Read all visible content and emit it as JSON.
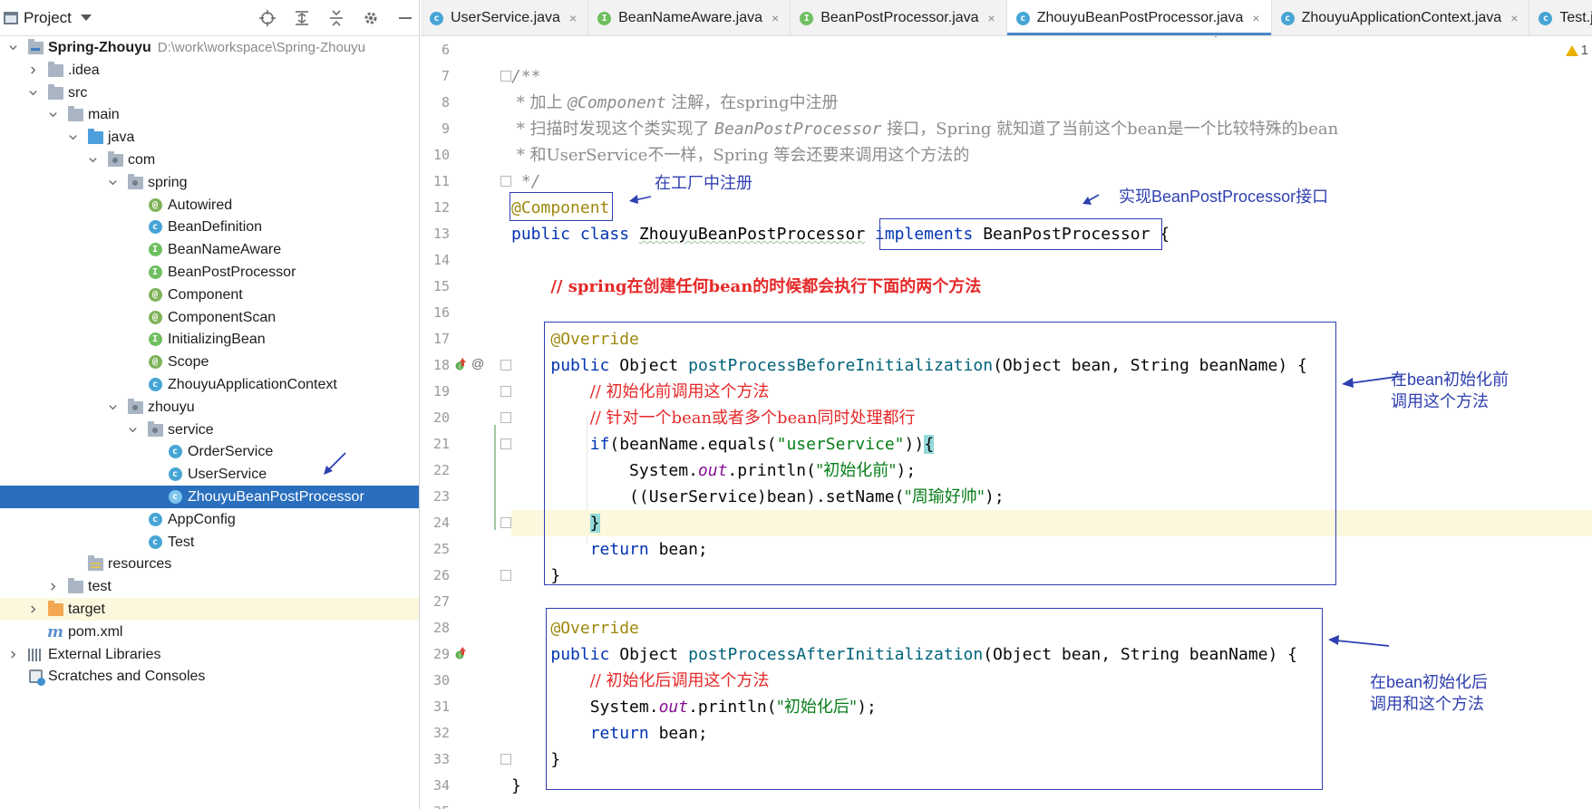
{
  "project_panel": {
    "title": "Project",
    "tree": [
      {
        "label": "Spring-Zhouyu",
        "path": "D:\\work\\workspace\\Spring-Zhouyu",
        "icon": "module-folder-icon",
        "depth": 0,
        "expanded": true
      },
      {
        "label": ".idea",
        "icon": "folder-icon",
        "depth": 1,
        "expanded": false
      },
      {
        "label": "src",
        "icon": "folder-icon",
        "depth": 1,
        "expanded": true
      },
      {
        "label": "main",
        "icon": "folder-icon",
        "depth": 2,
        "expanded": true
      },
      {
        "label": "java",
        "icon": "source-folder-icon",
        "depth": 3,
        "expanded": true
      },
      {
        "label": "com",
        "icon": "package-icon",
        "depth": 4,
        "expanded": true
      },
      {
        "label": "spring",
        "icon": "package-icon",
        "depth": 5,
        "expanded": true
      },
      {
        "label": "Autowired",
        "icon": "annotation-icon",
        "depth": 6
      },
      {
        "label": "BeanDefinition",
        "icon": "class-icon",
        "depth": 6
      },
      {
        "label": "BeanNameAware",
        "icon": "interface-icon",
        "depth": 6
      },
      {
        "label": "BeanPostProcessor",
        "icon": "interface-icon",
        "depth": 6
      },
      {
        "label": "Component",
        "icon": "annotation-icon",
        "depth": 6
      },
      {
        "label": "ComponentScan",
        "icon": "annotation-icon",
        "depth": 6
      },
      {
        "label": "InitializingBean",
        "icon": "interface-icon",
        "depth": 6
      },
      {
        "label": "Scope",
        "icon": "annotation-icon",
        "depth": 6
      },
      {
        "label": "ZhouyuApplicationContext",
        "icon": "class-icon",
        "depth": 6
      },
      {
        "label": "zhouyu",
        "icon": "package-icon",
        "depth": 5,
        "expanded": true
      },
      {
        "label": "service",
        "icon": "package-icon",
        "depth": 6,
        "expanded": true
      },
      {
        "label": "OrderService",
        "icon": "class-icon",
        "depth": 7
      },
      {
        "label": "UserService",
        "icon": "class-icon",
        "depth": 7
      },
      {
        "label": "ZhouyuBeanPostProcessor",
        "icon": "class-icon",
        "depth": 7,
        "selected": true
      },
      {
        "label": "AppConfig",
        "icon": "class-icon",
        "depth": 6
      },
      {
        "label": "Test",
        "icon": "runnable-class-icon",
        "depth": 6
      },
      {
        "label": "resources",
        "icon": "resources-folder-icon",
        "depth": 3
      },
      {
        "label": "test",
        "icon": "folder-icon",
        "depth": 2,
        "expanded": false
      },
      {
        "label": "target",
        "icon": "excluded-folder-icon",
        "depth": 1,
        "expanded": false,
        "highlighted": true
      },
      {
        "label": "pom.xml",
        "icon": "maven-icon",
        "depth": 1
      },
      {
        "label": "External Libraries",
        "icon": "library-icon",
        "depth": 0,
        "expanded": false
      },
      {
        "label": "Scratches and Consoles",
        "icon": "scratch-icon",
        "depth": 0
      }
    ]
  },
  "tabs": [
    {
      "label": "UserService.java",
      "icon": "class-icon",
      "close": "×"
    },
    {
      "label": "BeanNameAware.java",
      "icon": "interface-icon",
      "close": "×"
    },
    {
      "label": "BeanPostProcessor.java",
      "icon": "interface-icon",
      "close": "×"
    },
    {
      "label": "ZhouyuBeanPostProcessor.java",
      "icon": "class-icon",
      "close": "×",
      "active": true
    },
    {
      "label": "ZhouyuApplicationContext.java",
      "icon": "class-icon",
      "close": "×"
    },
    {
      "label": "Test.ja",
      "icon": "runnable-class-icon",
      "close": ""
    }
  ],
  "editor": {
    "warning_count": "1",
    "line_numbers": [
      "6",
      "7",
      "8",
      "9",
      "10",
      "11",
      "12",
      "13",
      "14",
      "15",
      "16",
      "17",
      "18",
      "19",
      "20",
      "21",
      "22",
      "23",
      "24",
      "25",
      "26",
      "27",
      "28",
      "29",
      "30",
      "31",
      "32",
      "33",
      "34",
      "35"
    ],
    "code": {
      "l7": "/**",
      "l8_a": " * 加上 ",
      "l8_b": "@Component",
      "l8_c": " 注解，在spring中注册",
      "l9_a": " * 扫描时发现这个类实现了 ",
      "l9_b": "BeanPostProcessor",
      "l9_c": " 接口，Spring 就知道了当前这个bean是一个比较特殊的bean",
      "l10": " * 和UserService不一样，Spring 等会还要来调用这个方法的",
      "l11": " */",
      "l12": "@Component",
      "l13_kw1": "public",
      "l13_kw2": "class",
      "l13_name": "ZhouyuBeanPostProcessor",
      "l13_kw3": "implements",
      "l13_iface": "BeanPostProcessor",
      "l13_brace": "{",
      "l15": "// spring在创建任何bean的时候都会执行下面的两个方法",
      "l17": "@Override",
      "l18_kw": "public",
      "l18_type": "Object",
      "l18_fn": "postProcessBeforeInitialization",
      "l18_params": "(Object bean, String beanName) {",
      "l19": "// 初始化前调用这个方法",
      "l20": "// 针对一个bean或者多个bean同时处理都行",
      "l21_kw": "if",
      "l21_a": "(beanName.equals(",
      "l21_str": "\"userService\"",
      "l21_b": "))",
      "l21_brace": "{",
      "l22_a": "System.",
      "l22_field": "out",
      "l22_b": ".println(",
      "l22_str": "\"初始化前\"",
      "l22_c": ");",
      "l23_a": "((UserService)bean).setName(",
      "l23_str": "\"周瑜好帅\"",
      "l23_b": ");",
      "l24": "}",
      "l25_kw": "return",
      "l25_b": " bean;",
      "l26": "}",
      "l28": "@Override",
      "l29_kw": "public",
      "l29_type": "Object",
      "l29_fn": "postProcessAfterInitialization",
      "l29_params": "(Object bean, String beanName) {",
      "l30": "// 初始化后调用这个方法",
      "l31_a": "System.",
      "l31_field": "out",
      "l31_b": ".println(",
      "l31_str": "\"初始化后\"",
      "l31_c": ");",
      "l32_kw": "return",
      "l32_b": " bean;",
      "l33": "}",
      "l34": "}"
    }
  },
  "annotations": {
    "register_note": "在工厂中注册",
    "implements_note": "实现BeanPostProcessor接口",
    "before_note_1": "在bean初始化前",
    "before_note_2": "调用这个方法",
    "after_note_1": "在bean初始化后",
    "after_note_2": "调用和这个方法"
  },
  "colors": {
    "annotation_ink": "#2e3fb0",
    "selection": "#2a6fbe",
    "keyword": "#0033b3",
    "red_comment": "#e62828"
  }
}
